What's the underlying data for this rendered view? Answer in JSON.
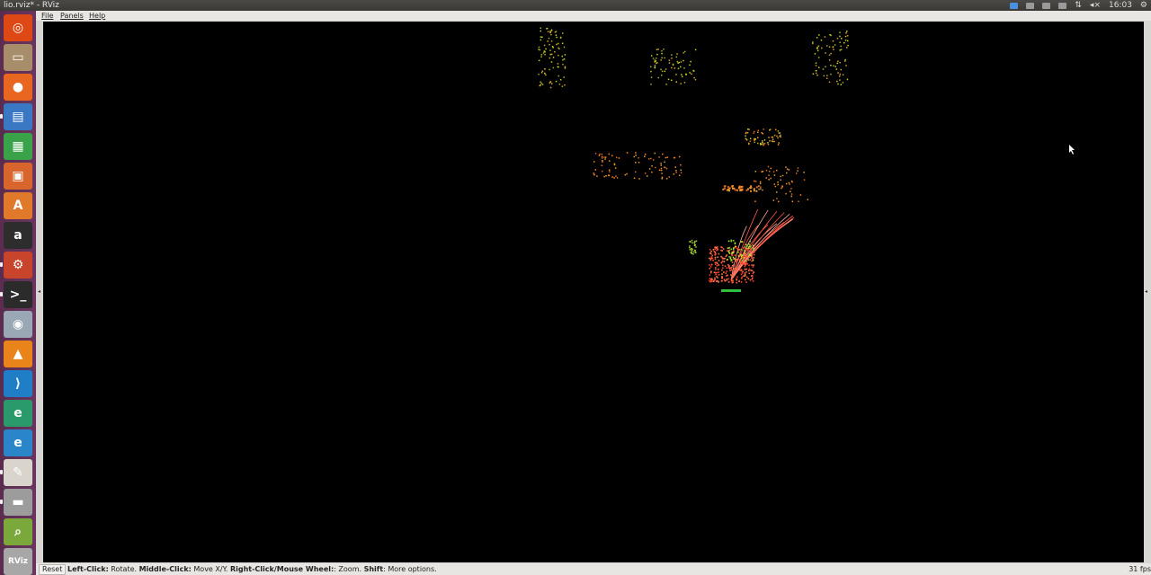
{
  "window": {
    "title": "lio.rviz* - RViz"
  },
  "tray": {
    "clock": "16:03"
  },
  "menu": {
    "file": "File",
    "panels": "Panels",
    "help": "Help"
  },
  "launcher": {
    "items": [
      {
        "name": "dash-home-icon",
        "glyph": "◎",
        "color": "#dd4814"
      },
      {
        "name": "files-icon",
        "glyph": "▭",
        "color": "#a88d6a"
      },
      {
        "name": "firefox-icon",
        "glyph": "●",
        "color": "#e8661f"
      },
      {
        "name": "writer-icon",
        "glyph": "▤",
        "color": "#3a78c4"
      },
      {
        "name": "calc-icon",
        "glyph": "▦",
        "color": "#3aa34a"
      },
      {
        "name": "impress-icon",
        "glyph": "▣",
        "color": "#d8652c"
      },
      {
        "name": "software-center-icon",
        "glyph": "A",
        "color": "#e07a2a"
      },
      {
        "name": "amazon-icon",
        "glyph": "a",
        "color": "#2d2d2d"
      },
      {
        "name": "system-settings-icon",
        "glyph": "⚙",
        "color": "#c8442a"
      },
      {
        "name": "terminal-icon",
        "glyph": ">_",
        "color": "#2b2b2b"
      },
      {
        "name": "screenshot-icon",
        "glyph": "◉",
        "color": "#9aa7b5"
      },
      {
        "name": "vlc-icon",
        "glyph": "▲",
        "color": "#e8841a"
      },
      {
        "name": "vscode-icon",
        "glyph": "⟩",
        "color": "#1f7ec6"
      },
      {
        "name": "edge-dev-icon",
        "glyph": "e",
        "color": "#2b9a6a"
      },
      {
        "name": "edge-icon",
        "glyph": "e",
        "color": "#2a86c8"
      },
      {
        "name": "text-editor-icon",
        "glyph": "✎",
        "color": "#d9d4cc"
      },
      {
        "name": "disks-icon",
        "glyph": "▬",
        "color": "#9c9c9c"
      },
      {
        "name": "image-viewer-icon",
        "glyph": "⌕",
        "color": "#7aa83a"
      },
      {
        "name": "rviz-icon",
        "glyph": "RViz",
        "color": "#a7a7a7"
      }
    ]
  },
  "status": {
    "reset": "Reset",
    "hint_left_key": "Left-Click:",
    "hint_left_val": " Rotate. ",
    "hint_mid_key": "Middle-Click:",
    "hint_mid_val": " Move X/Y. ",
    "hint_right_key": "Right-Click/Mouse Wheel:",
    "hint_right_val": ": Zoom. ",
    "hint_shift_key": "Shift",
    "hint_shift_val": ": More options.",
    "fps": "31 fps"
  },
  "colors": {
    "background": "#000000",
    "cloud_near": "#ff3b2a",
    "cloud_mid": "#ff8a1e",
    "cloud_far": "#c8d21e"
  }
}
